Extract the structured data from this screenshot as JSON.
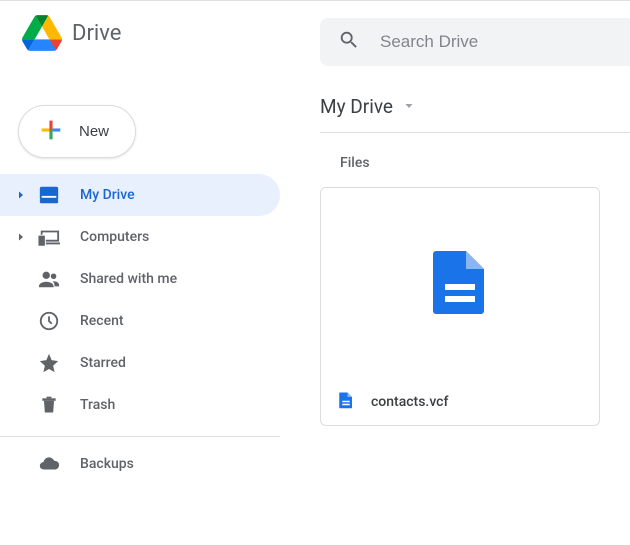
{
  "header": {
    "title": "Drive"
  },
  "search": {
    "placeholder": "Search Drive"
  },
  "new_button": {
    "label": "New"
  },
  "sidebar": {
    "items": [
      {
        "label": "My Drive"
      },
      {
        "label": "Computers"
      },
      {
        "label": "Shared with me"
      },
      {
        "label": "Recent"
      },
      {
        "label": "Starred"
      },
      {
        "label": "Trash"
      },
      {
        "label": "Backups"
      }
    ]
  },
  "breadcrumb": {
    "current": "My Drive"
  },
  "section": {
    "files_label": "Files"
  },
  "files": [
    {
      "name": "contacts.vcf"
    }
  ]
}
